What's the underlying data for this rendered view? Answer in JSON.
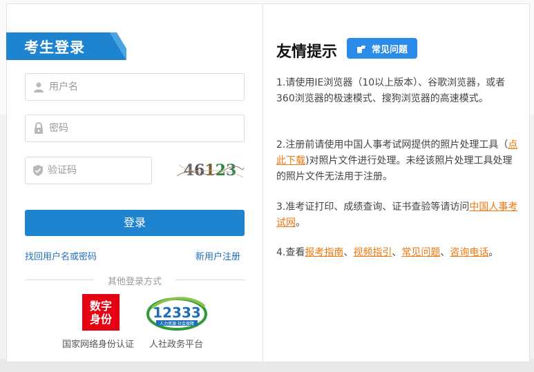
{
  "login": {
    "title": "考生登录",
    "username_placeholder": "用户名",
    "password_placeholder": "密码",
    "captcha_placeholder": "验证码",
    "captcha_chars": [
      "4",
      "6",
      "1",
      "2",
      "3"
    ],
    "login_button": "登录",
    "recover_link": "找回用户名或密码",
    "register_link": "新用户注册",
    "other_methods": "其他登录方式",
    "methods": [
      {
        "icon_text_1": "数字",
        "icon_text_2": "身份",
        "label": "国家网络身份认证"
      },
      {
        "icon_text": "12333",
        "icon_subtext": "人力资源 社会保障",
        "label": "人社政务平台"
      }
    ]
  },
  "tips": {
    "title": "友情提示",
    "faq_button": "常见问题",
    "tip1": "1.请使用IE浏览器（10以上版本）、谷歌浏览器，或者360浏览器的极速模式、搜狗浏览器的高速模式。",
    "tip2_a": "2.注册前请使用中国人事考试网提供的照片处理工具（",
    "tip2_link": "点此下载",
    "tip2_b": ")对照片文件进行处理。未经该照片处理工具处理的照片文件无法用于注册。",
    "tip3_a": "3.准考证打印、成绩查询、证书查验等请访问",
    "tip3_link": "中国人事考试网",
    "tip3_b": "。",
    "tip4_a": "4.查看",
    "tip4_link1": "报考指南",
    "tip4_sep1": "、",
    "tip4_link2": "视频指引",
    "tip4_sep2": "、",
    "tip4_link3": "常见问题",
    "tip4_sep3": "、",
    "tip4_link4": "咨询电话",
    "tip4_end": "。"
  },
  "colors": {
    "accent": "#1f84d0",
    "link": "#1f6fc0",
    "highlight_link": "#f07810",
    "badge_red": "#e50012"
  }
}
